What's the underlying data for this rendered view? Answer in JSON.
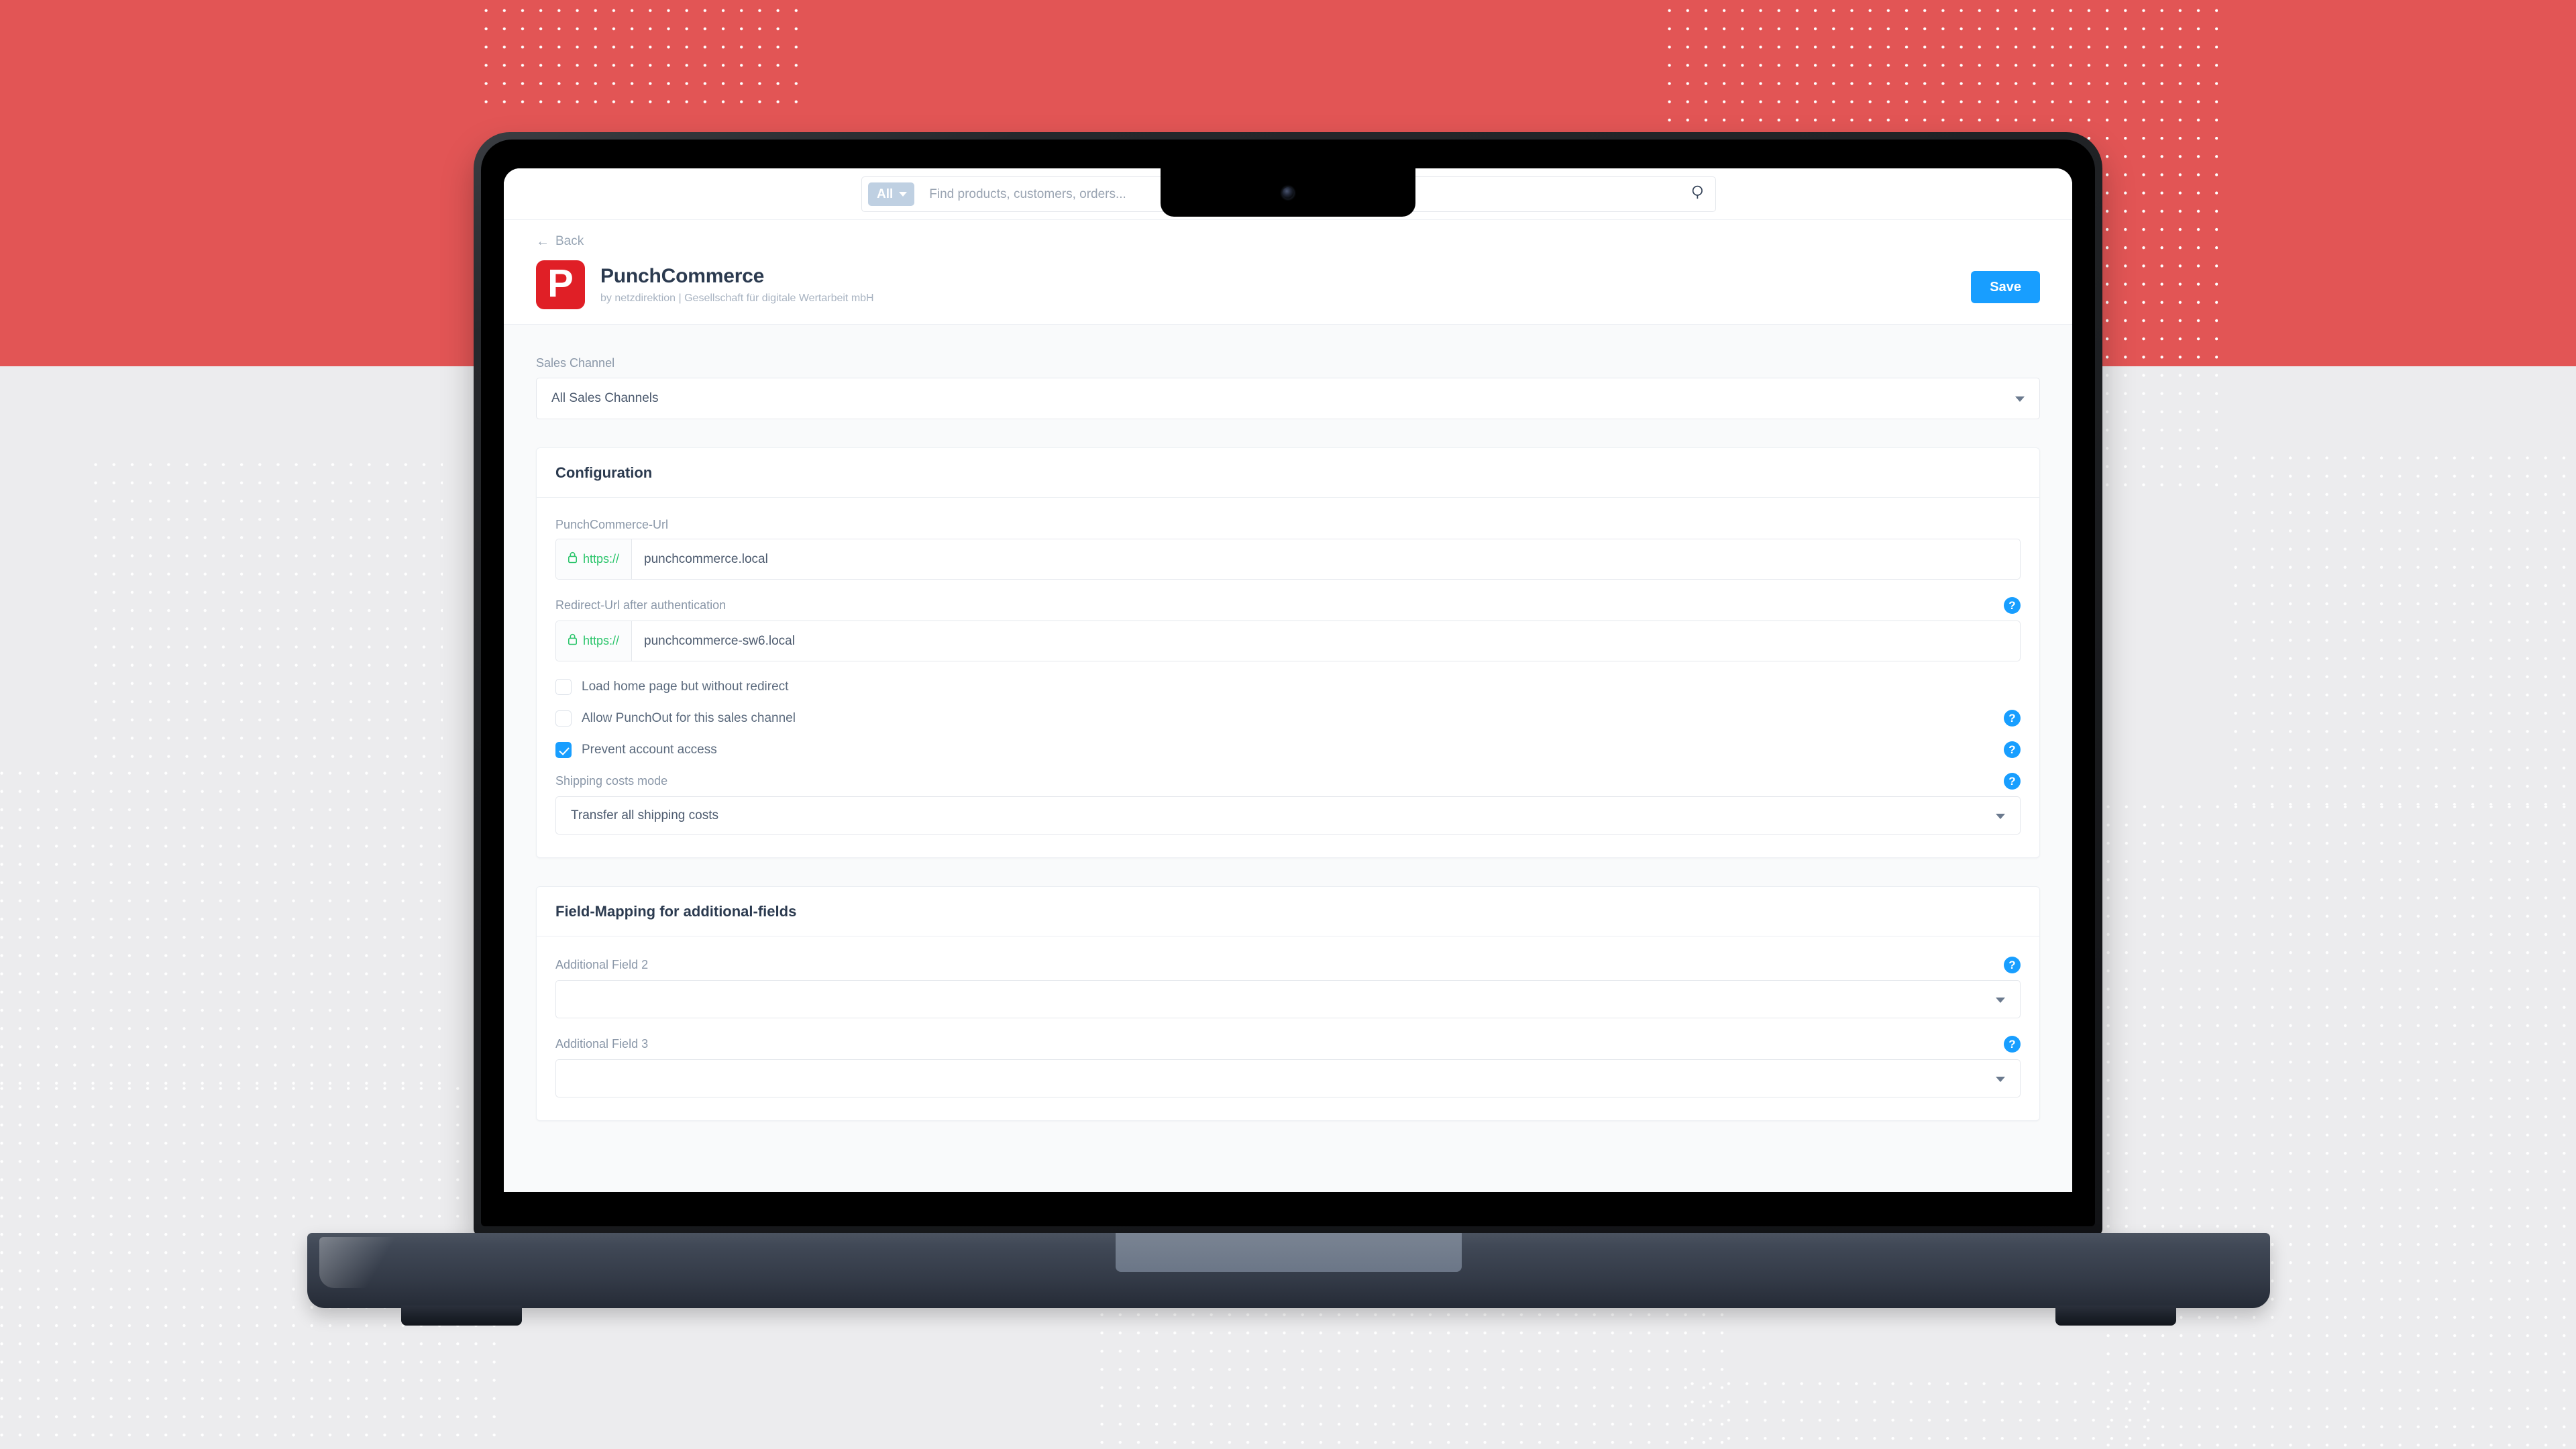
{
  "topbar": {
    "scope_label": "All",
    "search_placeholder": "Find products, customers, orders...",
    "search_value": "",
    "search_icon": "search-icon",
    "chevron_icon": "chevron-down-icon"
  },
  "page_header": {
    "back_label": "Back",
    "back_arrow": "←",
    "logo_letter": "P",
    "logo_color": "#e01f26",
    "title": "PunchCommerce",
    "subtitle": "by netzdirektion | Gesellschaft für digitale Wertarbeit mbH",
    "save_label": "Save",
    "save_color": "#189eff"
  },
  "sales_channel": {
    "label": "Sales Channel",
    "value": "All Sales Channels"
  },
  "configuration": {
    "title": "Configuration",
    "punchcommerce_url": {
      "label": "PunchCommerce-Url",
      "prefix": "https://",
      "value": "punchcommerce.local",
      "prefix_color": "#2bc56b"
    },
    "redirect_url": {
      "label": "Redirect-Url after authentication",
      "prefix": "https://",
      "value": "punchcommerce-sw6.local",
      "help": "?"
    },
    "checkboxes": [
      {
        "label": "Load home page but without redirect",
        "checked": false,
        "help": null
      },
      {
        "label": "Allow PunchOut for this sales channel",
        "checked": false,
        "help": "?"
      },
      {
        "label": "Prevent account access",
        "checked": true,
        "help": "?"
      }
    ],
    "shipping_costs_mode": {
      "label": "Shipping costs mode",
      "value": "Transfer all shipping costs",
      "help": "?"
    }
  },
  "field_mapping": {
    "title": "Field-Mapping for additional-fields",
    "fields": [
      {
        "label": "Additional Field 2",
        "value": "",
        "help": "?"
      },
      {
        "label": "Additional Field 3",
        "value": "",
        "help": "?"
      }
    ]
  },
  "theme": {
    "accent_blue": "#189eff",
    "bg_red": "#e25555",
    "bg_gray": "#ececee"
  }
}
